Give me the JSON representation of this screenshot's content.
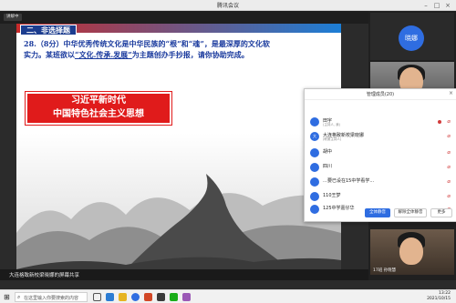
{
  "window": {
    "title": "腾讯会议"
  },
  "toolbar": {
    "badge": "讲解中"
  },
  "slide": {
    "section_tag": "二、非选择题",
    "question_line1": "28.（8分）中华优秀传统文化是中华民族的“根”和“魂”，是最深厚的文化软",
    "question_line2a": "实力。某班欲以",
    "question_underlined": "“文化.传承.发展”",
    "question_line2b": "为主题创办手抄报，请你协助完成。",
    "banner_line1": "习近平新时代",
    "banner_line2": "中国特色社会主义思想"
  },
  "sharebar": {
    "label": "大连格致新校梁晓娜的屏幕共享"
  },
  "video": {
    "tile1_avatar": "晓娜",
    "tile1_name": "",
    "tile2_name": "正在讲话：大连格致新...",
    "tile3_name": "17班  孙晓慧"
  },
  "members_panel": {
    "title": "管理成员(20)",
    "members": [
      {
        "initial": "",
        "name": "田宇",
        "sub": "(主持人, 我)"
      },
      {
        "initial": "大",
        "name": "大连格致新校梁晓娜",
        "sub": "(联席主持人)"
      },
      {
        "initial": "",
        "name": "胡中",
        "sub": ""
      },
      {
        "initial": "",
        "name": "四川",
        "sub": ""
      },
      {
        "initial": "",
        "name": "…要已设在15中学看学...",
        "sub": ""
      },
      {
        "initial": "",
        "name": "110王梦",
        "sub": ""
      },
      {
        "initial": "",
        "name": "125中学嘉仔华",
        "sub": ""
      }
    ],
    "buttons": {
      "mute_all": "全体静音",
      "unmute_all": "解除全体静音",
      "more": "更多"
    }
  },
  "taskbar": {
    "search_placeholder": "在这里输入你要搜索的内容",
    "time": "13:22",
    "date": "2021/10/15"
  },
  "colors": {
    "accent": "#2f6de1",
    "banner_red": "#e01b1b",
    "question_blue": "#1b3b9e"
  }
}
